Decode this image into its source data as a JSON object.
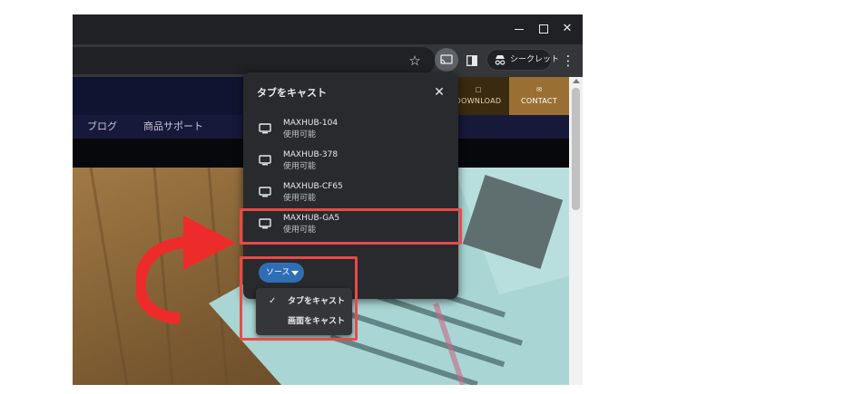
{
  "browser": {
    "window_controls": {
      "minimize_icon": "minimize-icon",
      "maximize_icon": "maximize-icon",
      "close_icon": "close-icon"
    },
    "toolbar": {
      "bookmark_icon": "star-icon",
      "cast_icon": "cast-icon",
      "side_panel_icon": "side-panel-icon",
      "incognito_label": "シークレット",
      "menu_icon": "kebab-menu-icon"
    }
  },
  "site": {
    "header": {
      "download_label": "DOWNLOAD",
      "contact_label": "CONTACT"
    },
    "nav": {
      "blog": "ブログ",
      "product_support": "商品サポート"
    }
  },
  "cast_dialog": {
    "title": "タブをキャスト",
    "close_icon": "close-icon",
    "devices": [
      {
        "name": "MAXHUB-104",
        "status": "使用可能"
      },
      {
        "name": "MAXHUB-378",
        "status": "使用可能"
      },
      {
        "name": "MAXHUB-CF65",
        "status": "使用可能"
      },
      {
        "name": "MAXHUB-GA5",
        "status": "使用可能"
      }
    ],
    "sources_button": "ソース",
    "source_menu": [
      {
        "label": "タブをキャスト",
        "checked": true
      },
      {
        "label": "画面をキャスト",
        "checked": false
      }
    ]
  },
  "colors": {
    "highlight": "#e84a4a",
    "dialog_bg": "#292a2d",
    "accent_button": "#2f6eb5",
    "contact_bg": "#9a6f33"
  }
}
